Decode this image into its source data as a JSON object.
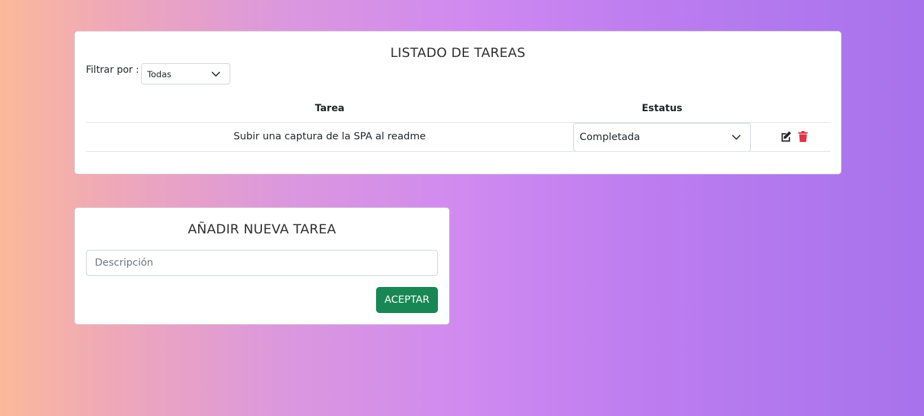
{
  "task_list": {
    "title": "LISTADO DE TAREAS",
    "filter": {
      "label": "Filtrar por :",
      "selected": "Todas"
    },
    "columns": [
      "Tarea",
      "Estatus"
    ],
    "rows": [
      {
        "task": "Subir una captura de la SPA al readme",
        "status": "Completada",
        "actions": [
          "edit-icon",
          "trash-icon"
        ]
      }
    ]
  },
  "add_task": {
    "title": "AÑADIR NUEVA TAREA",
    "description_placeholder": "Descripción",
    "description_value": "",
    "accept_label": "ACEPTAR"
  },
  "colors": {
    "accept_button": "#198754",
    "delete_icon": "#dc3545",
    "edit_icon": "#212529",
    "background_gradient": [
      "#fbb99a",
      "#d08af0",
      "#a772ec"
    ]
  }
}
